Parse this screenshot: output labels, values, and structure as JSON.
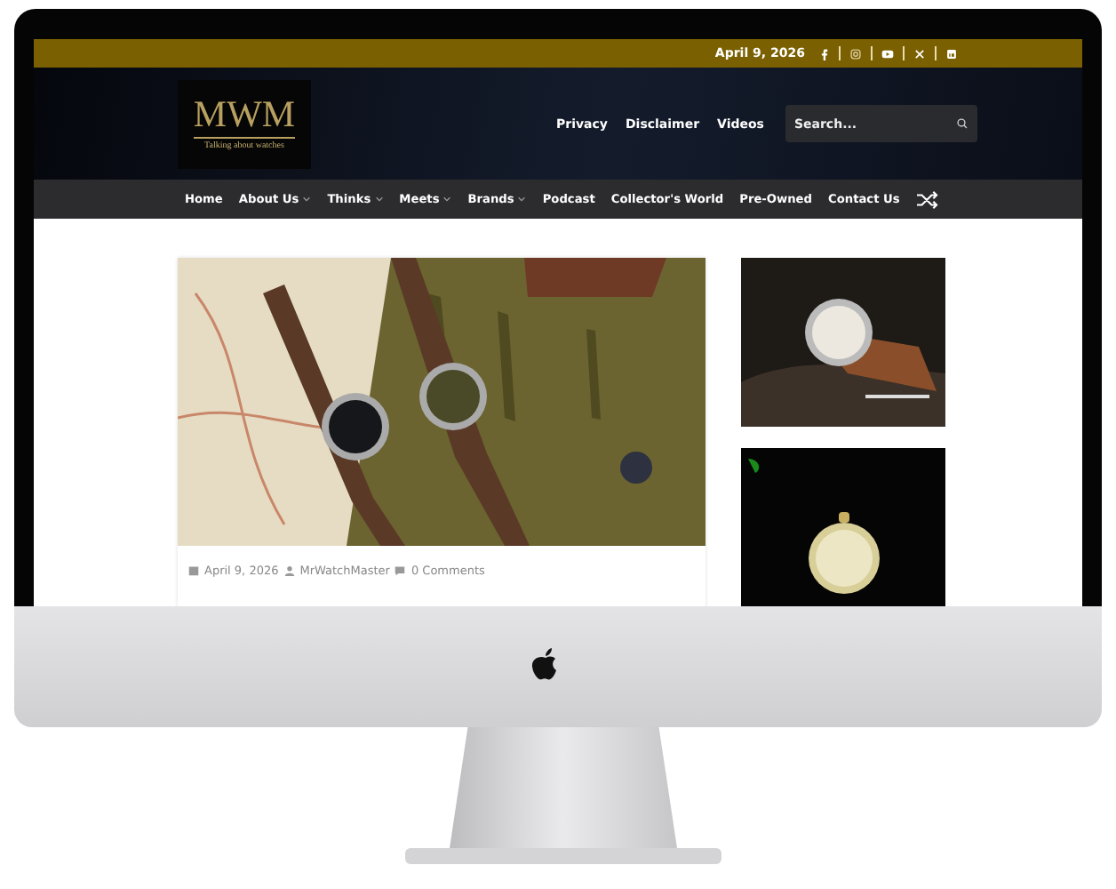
{
  "topbar": {
    "date": "April 9, 2026"
  },
  "logo": {
    "text": "MWM",
    "tagline": "Talking about watches"
  },
  "header_links": [
    "Privacy",
    "Disclaimer",
    "Videos"
  ],
  "search": {
    "placeholder": "Search..."
  },
  "nav": [
    {
      "label": "Home",
      "dropdown": false
    },
    {
      "label": "About Us",
      "dropdown": true
    },
    {
      "label": "Thinks",
      "dropdown": true
    },
    {
      "label": "Meets",
      "dropdown": true
    },
    {
      "label": "Brands",
      "dropdown": true
    },
    {
      "label": "Podcast",
      "dropdown": false
    },
    {
      "label": "Collector's World",
      "dropdown": false
    },
    {
      "label": "Pre-Owned",
      "dropdown": false
    },
    {
      "label": "Contact Us",
      "dropdown": false
    }
  ],
  "post": {
    "date": "April 9, 2026",
    "author": "MrWatchMaster",
    "comments": "0 Comments"
  }
}
